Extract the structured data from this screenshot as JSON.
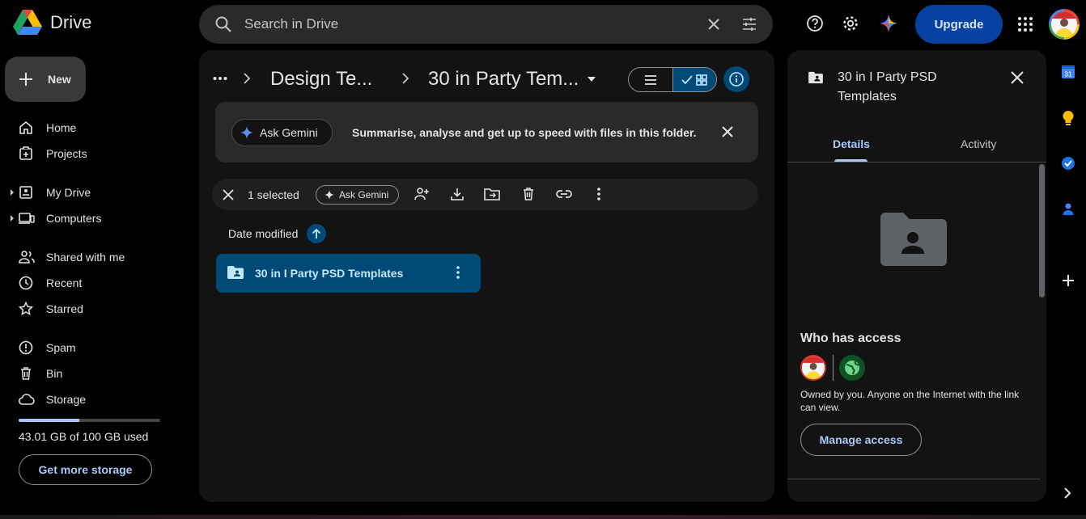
{
  "app": {
    "title": "Drive"
  },
  "search": {
    "placeholder": "Search in Drive"
  },
  "header": {
    "upgrade_label": "Upgrade"
  },
  "sidebar": {
    "new_label": "New",
    "items": [
      {
        "label": "Home",
        "icon": "home-icon"
      },
      {
        "label": "Projects",
        "icon": "projects-icon"
      },
      {
        "label": "My Drive",
        "icon": "my-drive-icon"
      },
      {
        "label": "Computers",
        "icon": "computers-icon"
      },
      {
        "label": "Shared with me",
        "icon": "shared-icon"
      },
      {
        "label": "Recent",
        "icon": "clock-icon"
      },
      {
        "label": "Starred",
        "icon": "star-icon"
      },
      {
        "label": "Spam",
        "icon": "spam-icon"
      },
      {
        "label": "Bin",
        "icon": "trash-icon"
      },
      {
        "label": "Storage",
        "icon": "cloud-icon"
      }
    ],
    "storage": {
      "used_fraction": 0.4301,
      "text": "43.01 GB of 100 GB used",
      "button_label": "Get more storage"
    }
  },
  "breadcrumb": {
    "parent": "Design Te...",
    "current": "30 in Party Tem..."
  },
  "gemini_banner": {
    "chip_label": "Ask Gemini",
    "text": "Summarise, analyse and get up to speed with files in this folder."
  },
  "selection": {
    "count_label": "1 selected",
    "gemini_label": "Ask Gemini"
  },
  "sort": {
    "label": "Date modified",
    "direction": "ascending"
  },
  "files": [
    {
      "name": "30 in I Party PSD Templates",
      "type": "shared-folder",
      "selected": true
    }
  ],
  "details": {
    "title": "30 in I Party PSD Templates",
    "tabs": [
      "Details",
      "Activity"
    ],
    "active_tab": "Details",
    "who_has_access": "Who has access",
    "access_description": "Owned by you. Anyone on the Internet with the link can view.",
    "manage_access_label": "Manage access"
  },
  "colors": {
    "accent": "#a8c7fa",
    "selected_bg": "#004a77",
    "upgrade_bg": "#0842a0"
  }
}
